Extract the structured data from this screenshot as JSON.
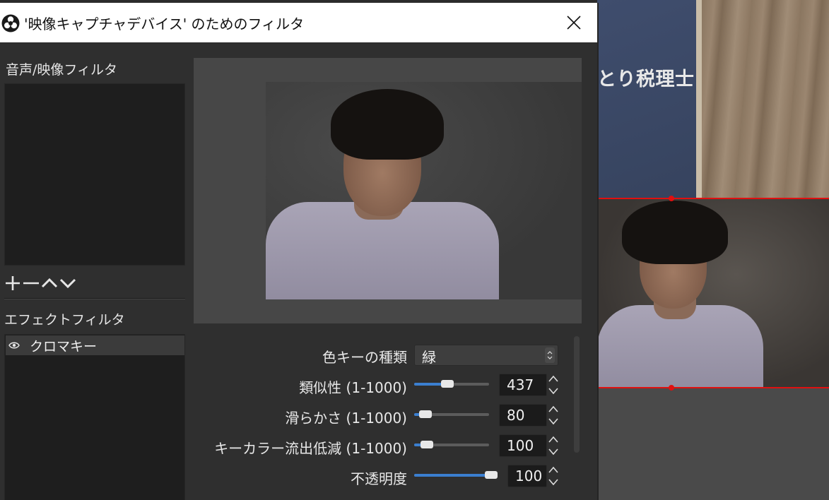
{
  "window": {
    "title": "'映像キャプチャデバイス' のためのフィルタ"
  },
  "audio_video_filters": {
    "label": "音声/映像フィルタ",
    "items": []
  },
  "effect_filters": {
    "label": "エフェクトフィルタ",
    "items": [
      {
        "label": "クロマキー",
        "visible": true,
        "selected": true
      }
    ]
  },
  "properties": {
    "key_color_type": {
      "label": "色キーの種類",
      "value": "緑"
    },
    "similarity": {
      "label": "類似性 (1-1000)",
      "value": "437",
      "min": 1,
      "max": 1000
    },
    "smoothness": {
      "label": "滑らかさ (1-1000)",
      "value": "80",
      "min": 1,
      "max": 1000
    },
    "spill_reduction": {
      "label": "キーカラー流出低減 (1-1000)",
      "value": "100",
      "min": 1,
      "max": 1000
    },
    "opacity": {
      "label": "不透明度",
      "value": "100",
      "min": 0,
      "max": 100
    }
  },
  "background_poster_text": "とり税理士",
  "colors": {
    "accent": "#3b7fd0",
    "selection_border": "#e01010",
    "dialog_bg": "#2f2f2f"
  },
  "icons": {
    "app": "obs-logo-icon",
    "close": "close-icon",
    "add": "plus-icon",
    "remove": "minus-icon",
    "move_up": "chevron-up-icon",
    "move_down": "chevron-down-icon",
    "visibility": "eye-icon"
  }
}
